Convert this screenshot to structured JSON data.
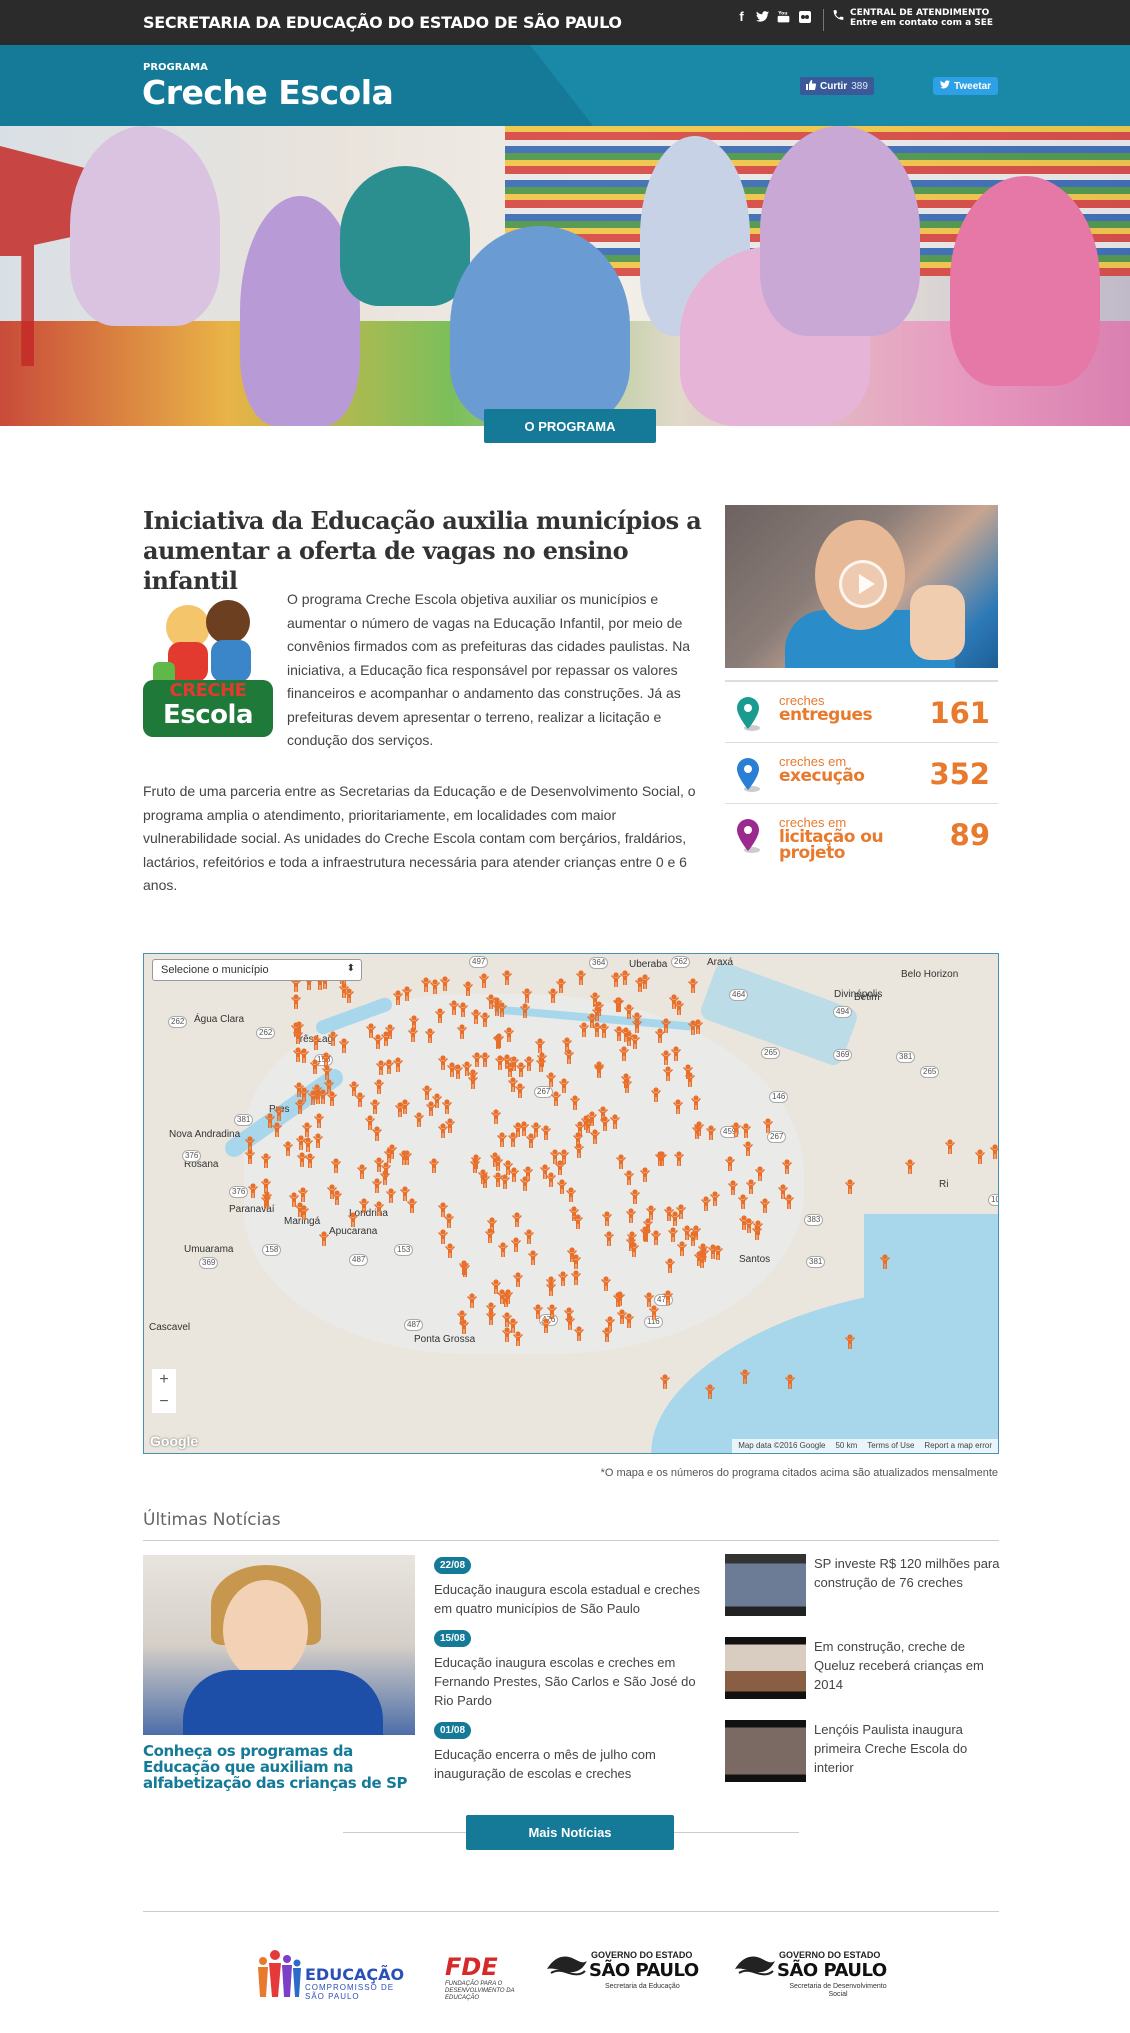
{
  "topbar": {
    "site_title": "SECRETARIA DA EDUCAÇÃO DO ESTADO DE SÃO PAULO",
    "social_icons": [
      "facebook-icon",
      "twitter-icon",
      "youtube-icon",
      "flickr-icon"
    ],
    "contact_title": "CENTRAL DE ATENDIMENTO",
    "contact_subtitle": "Entre em contato com a SEE"
  },
  "header": {
    "kicker": "PROGRAMA",
    "title": "Creche Escola",
    "like_label": "Curtir",
    "like_count": "389",
    "tweet_label": "Tweetar"
  },
  "hero": {
    "button_label": "O PROGRAMA"
  },
  "intro": {
    "headline": "Iniciativa da Educação auxilia municípios a aumentar a oferta de vagas no ensino infantil",
    "logo_text_1": "CRECHE",
    "logo_text_2": "Escola",
    "paragraph1": "O programa Creche Escola objetiva auxiliar os municípios e aumentar o número de vagas na Educação Infantil, por meio de convênios firmados com as prefeituras das cidades paulistas. Na iniciativa, a Educação fica responsável por repassar os valores financeiros e acompanhar o andamento das construções. Já as prefeituras devem apresentar o terreno, realizar a licitação e condução dos serviços.",
    "paragraph2": "Fruto de uma parceria entre as Secretarias da Educação e de Desenvolvimento Social, o programa amplia o atendimento, prioritariamente, em localidades com maior vulnerabilidade social. As unidades do Creche Escola contam com berçários, fraldários, lactários, refeitórios e toda a infraestrutura necessária para atender crianças entre 0 e 6 anos."
  },
  "stats": [
    {
      "small": "creches",
      "big": "entregues",
      "value": "161",
      "pin_color": "#1a9b8f"
    },
    {
      "small": "creches em",
      "big": "execução",
      "value": "352",
      "pin_color": "#2a7fd4"
    },
    {
      "small": "creches em",
      "big": "licitação ou projeto",
      "value": "89",
      "pin_color": "#9b2a8f"
    }
  ],
  "map": {
    "select_placeholder": "Selecione o município",
    "zoom_in": "+",
    "zoom_out": "−",
    "google": "Google",
    "attribution": [
      "Map data ©2016 Google",
      "50 km",
      "Terms of Use",
      "Report a map error"
    ],
    "places": [
      "Uberaba",
      "Araxá",
      "Belo Horizon",
      "Divinópolis",
      "Betim",
      "Água Clara",
      "Três Lag",
      "Pres",
      "Nova Andradina",
      "Rosana",
      "Paranavaí",
      "Maringá",
      "Apucarana",
      "Londrina",
      "Umuarama",
      "Cascavel",
      "Ponta Grossa",
      "Santos",
      "Ri"
    ],
    "roads": [
      "497",
      "364",
      "262",
      "464",
      "262",
      "262",
      "158",
      "265",
      "369",
      "381",
      "494",
      "265",
      "146",
      "267",
      "381",
      "459",
      "267",
      "376",
      "376",
      "101",
      "158",
      "369",
      "487",
      "153",
      "476",
      "116",
      "478",
      "487",
      "383",
      "381"
    ],
    "marker_color": "#e8702a"
  },
  "map_note": "*O mapa e os números do programa citados acima são atualizados mensalmente",
  "news": {
    "section_title": "Últimas Notícias",
    "feature_title": "Conheça os programas da Educação que auxiliam na alfabetização das crianças de SP",
    "items": [
      {
        "date": "22/08",
        "text": "Educação inaugura escola estadual e creches em quatro municípios de São Paulo"
      },
      {
        "date": "15/08",
        "text": "Educação inaugura escolas e creches em Fernando Prestes, São Carlos e São José do Rio Pardo"
      },
      {
        "date": "01/08",
        "text": "Educação encerra o mês de julho com inauguração de escolas e creches"
      }
    ],
    "side": [
      {
        "text": "SP investe R$ 120 milhões para construção de 76 creches"
      },
      {
        "text": "Em construção, creche de Queluz receberá crianças em 2014"
      },
      {
        "text": "Lençóis Paulista inaugura primeira Creche Escola do interior"
      }
    ],
    "more_label": "Mais Notícias"
  },
  "footer": {
    "logo1_title": "EDUCAÇÃO",
    "logo1_sub": "COMPROMISSO DE SÃO PAULO",
    "logo2_title": "FDE",
    "logo2_sub": "FUNDAÇÃO PARA O DESENVOLVIMENTO DA EDUCAÇÃO",
    "logo3_kicker": "GOVERNO DO ESTADO",
    "logo3_title": "SÃO PAULO",
    "logo3_sub": "Secretaria da Educação",
    "logo4_kicker": "GOVERNO DO ESTADO",
    "logo4_title": "SÃO PAULO",
    "logo4_sub": "Secretaria de Desenvolvimento Social"
  }
}
